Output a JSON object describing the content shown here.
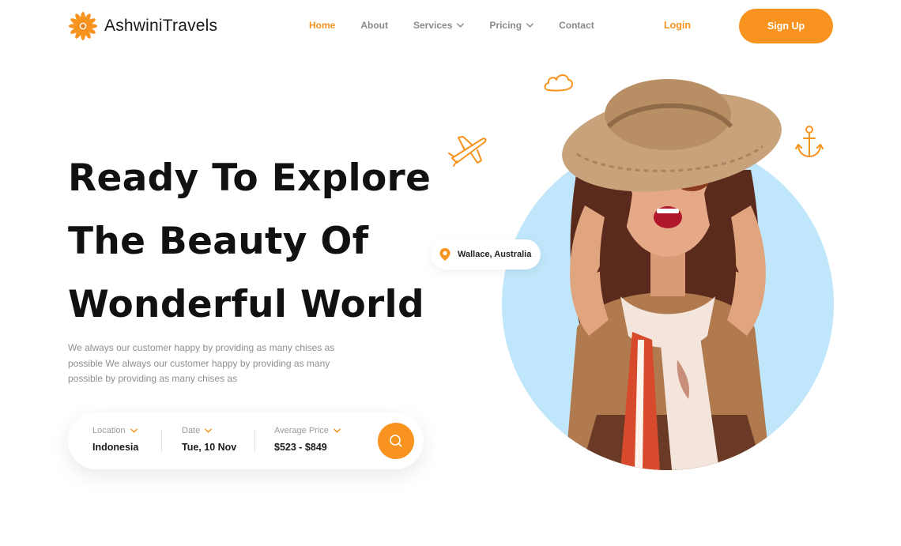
{
  "brand": {
    "name": "AshwiniTravels",
    "logo_icon": "sun-flower-icon"
  },
  "nav": {
    "items": [
      {
        "label": "Home",
        "active": true,
        "dropdown": false
      },
      {
        "label": "About",
        "active": false,
        "dropdown": false
      },
      {
        "label": "Services",
        "active": false,
        "dropdown": true
      },
      {
        "label": "Pricing",
        "active": false,
        "dropdown": true
      },
      {
        "label": "Contact",
        "active": false,
        "dropdown": false
      }
    ]
  },
  "auth": {
    "login_label": "Login",
    "signup_label": "Sign Up"
  },
  "hero": {
    "title_lines": [
      "Ready To Explore",
      "The Beauty Of",
      "Wonderful World"
    ],
    "description": "We always our customer happy by providing as many chises as possible We always our customer happy by providing as many possible by providing as many chises as"
  },
  "search": {
    "fields": [
      {
        "label": "Location",
        "value": "Indonesia"
      },
      {
        "label": "Date",
        "value": "Tue, 10 Nov"
      },
      {
        "label": "Average Price",
        "value": "$523 - $849"
      }
    ],
    "button_icon": "search-icon"
  },
  "location_chip": {
    "icon": "map-pin-icon",
    "text": "Wallace, Australia"
  },
  "decorations": [
    "cloud-icon",
    "airplane-icon",
    "anchor-icon"
  ],
  "colors": {
    "accent": "#f7931e",
    "circle": "#bfe6fa",
    "text_dark": "#111111",
    "text_muted": "#8f8f8f"
  }
}
